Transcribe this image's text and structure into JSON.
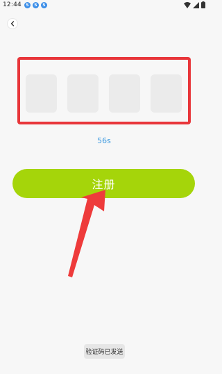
{
  "status_bar": {
    "time": "12:44",
    "notification_icons": [
      "notification-icon",
      "notification-icon",
      "notification-icon"
    ],
    "notification_glyph": "S",
    "accent_color": "#3c8ee8"
  },
  "header": {
    "back_icon": "chevron-left-icon"
  },
  "verification": {
    "code_boxes": [
      "",
      "",
      "",
      ""
    ],
    "countdown": "56s",
    "highlight_color": "#e8363a"
  },
  "actions": {
    "register_label": "注册",
    "register_color": "#a5d50a"
  },
  "toast": {
    "message": "验证码已发送"
  }
}
